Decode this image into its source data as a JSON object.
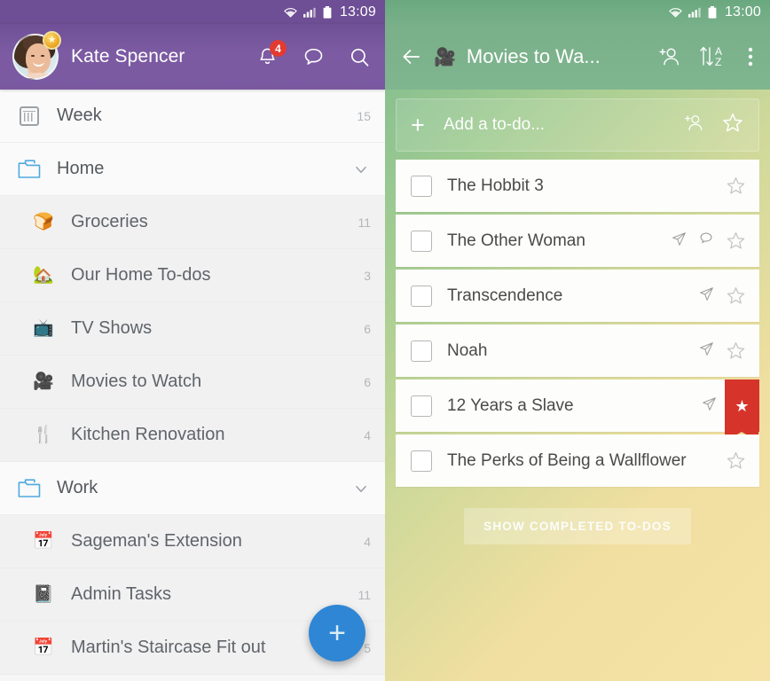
{
  "left": {
    "status": {
      "time": "13:09",
      "wifi_icon": "wifi-icon",
      "signal_icon": "signal-icon",
      "battery_icon": "battery-icon"
    },
    "header": {
      "user_name": "Kate Spencer",
      "avatar": "user-avatar",
      "pro_badge_icon": "star-badge-icon",
      "notifications_icon": "bell-icon",
      "notifications_count": "4",
      "chat_icon": "chat-bubble-icon",
      "search_icon": "search-icon",
      "bg_color": "#7a59a1"
    },
    "nav": [
      {
        "icon": "week-calendar-icon",
        "emoji": "",
        "label": "Week",
        "count": "15",
        "type": "top",
        "chevron": false
      },
      {
        "icon": "folder-icon",
        "emoji": "",
        "label": "Home",
        "count": "",
        "type": "folder",
        "chevron": true
      },
      {
        "icon": "bread-icon",
        "emoji": "🍞",
        "label": "Groceries",
        "count": "11",
        "type": "child",
        "chevron": false
      },
      {
        "icon": "house-with-garden-icon",
        "emoji": "🏡",
        "label": "Our Home To-dos",
        "count": "3",
        "type": "child",
        "chevron": false
      },
      {
        "icon": "television-icon",
        "emoji": "📺",
        "label": "TV Shows",
        "count": "6",
        "type": "child",
        "chevron": false
      },
      {
        "icon": "movie-camera-icon",
        "emoji": "🎥",
        "label": "Movies to Watch",
        "count": "6",
        "type": "child",
        "chevron": false
      },
      {
        "icon": "fork-and-knife-icon",
        "emoji": "🍴",
        "label": "Kitchen Renovation",
        "count": "4",
        "type": "child",
        "chevron": false
      },
      {
        "icon": "folder-icon",
        "emoji": "",
        "label": "Work",
        "count": "",
        "type": "folder",
        "chevron": true
      },
      {
        "icon": "calendar-icon",
        "emoji": "📅",
        "label": "Sageman's Extension",
        "count": "4",
        "type": "child",
        "chevron": false
      },
      {
        "icon": "notebook-icon",
        "emoji": "📓",
        "label": "Admin Tasks",
        "count": "11",
        "type": "child",
        "chevron": false
      },
      {
        "icon": "calendar-icon",
        "emoji": "📅",
        "label": "Martin's Staircase Fit out",
        "count": "5",
        "type": "child",
        "chevron": false
      }
    ],
    "fab": {
      "icon": "plus-icon",
      "label": "+",
      "color": "#2f86d4"
    }
  },
  "right": {
    "status": {
      "time": "13:00",
      "wifi_icon": "wifi-icon",
      "signal_icon": "signal-icon",
      "battery_icon": "battery-icon"
    },
    "header": {
      "back_icon": "back-arrow-icon",
      "list_emoji": "🎥",
      "title": "Movies to Wa...",
      "add_person_icon": "add-person-icon",
      "sort_az_icon": "sort-az-icon",
      "overflow_icon": "more-vertical-icon",
      "bg_color": "#7fb58f"
    },
    "add_todo": {
      "plus": "+",
      "placeholder": "Add a to-do...",
      "assign_icon": "add-person-icon",
      "star_icon": "star-outline-icon"
    },
    "todos": [
      {
        "label": "The Hobbit 3",
        "checked": false,
        "has_assignee": false,
        "has_comment": false,
        "starred": false
      },
      {
        "label": "The Other Woman",
        "checked": false,
        "has_assignee": true,
        "has_comment": true,
        "starred": false
      },
      {
        "label": "Transcendence",
        "checked": false,
        "has_assignee": true,
        "has_comment": false,
        "starred": false
      },
      {
        "label": "Noah",
        "checked": false,
        "has_assignee": true,
        "has_comment": false,
        "starred": false
      },
      {
        "label": "12 Years a Slave",
        "checked": false,
        "has_assignee": true,
        "has_comment": false,
        "starred": true
      },
      {
        "label": "The Perks of Being a Wallflower",
        "checked": false,
        "has_assignee": false,
        "has_comment": false,
        "starred": false
      }
    ],
    "show_completed_label": "SHOW COMPLETED TO-DOS",
    "star_ribbon_color": "#d6342b"
  }
}
